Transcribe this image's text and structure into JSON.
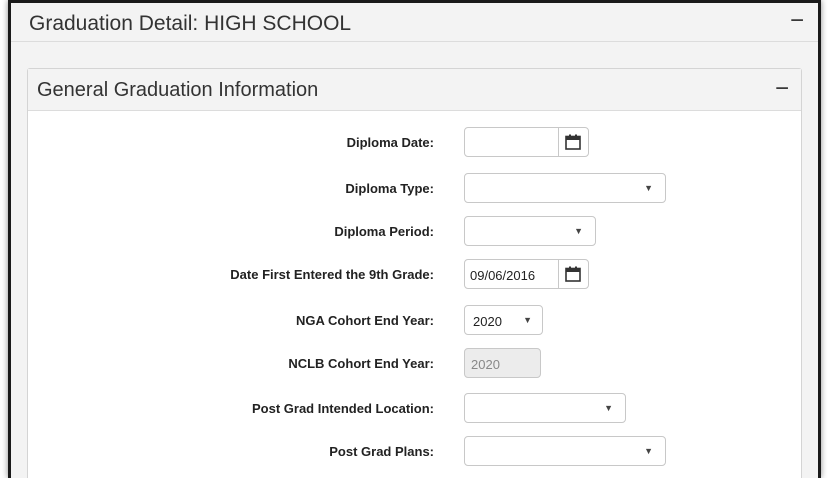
{
  "outer_panel": {
    "title": "Graduation Detail: HIGH SCHOOL",
    "collapse_symbol": "−"
  },
  "inner_panel": {
    "title": "General Graduation Information",
    "collapse_symbol": "−"
  },
  "fields": {
    "diploma_date": {
      "label": "Diploma Date:",
      "value": ""
    },
    "diploma_type": {
      "label": "Diploma Type:",
      "value": ""
    },
    "diploma_period": {
      "label": "Diploma Period:",
      "value": ""
    },
    "date_first_9th": {
      "label": "Date First Entered the 9th Grade:",
      "value": "09/06/2016"
    },
    "nga_cohort": {
      "label": "NGA Cohort End Year:",
      "value": "2020"
    },
    "nclb_cohort": {
      "label": "NCLB Cohort End Year:",
      "value": "2020"
    },
    "post_grad_location": {
      "label": "Post Grad Intended Location:",
      "value": ""
    },
    "post_grad_plans": {
      "label": "Post Grad Plans:",
      "value": ""
    }
  },
  "icons": {
    "calendar": "calendar-icon",
    "dropdown": "caret-down-icon",
    "collapse": "minus-icon"
  },
  "caret_symbol": "▼"
}
